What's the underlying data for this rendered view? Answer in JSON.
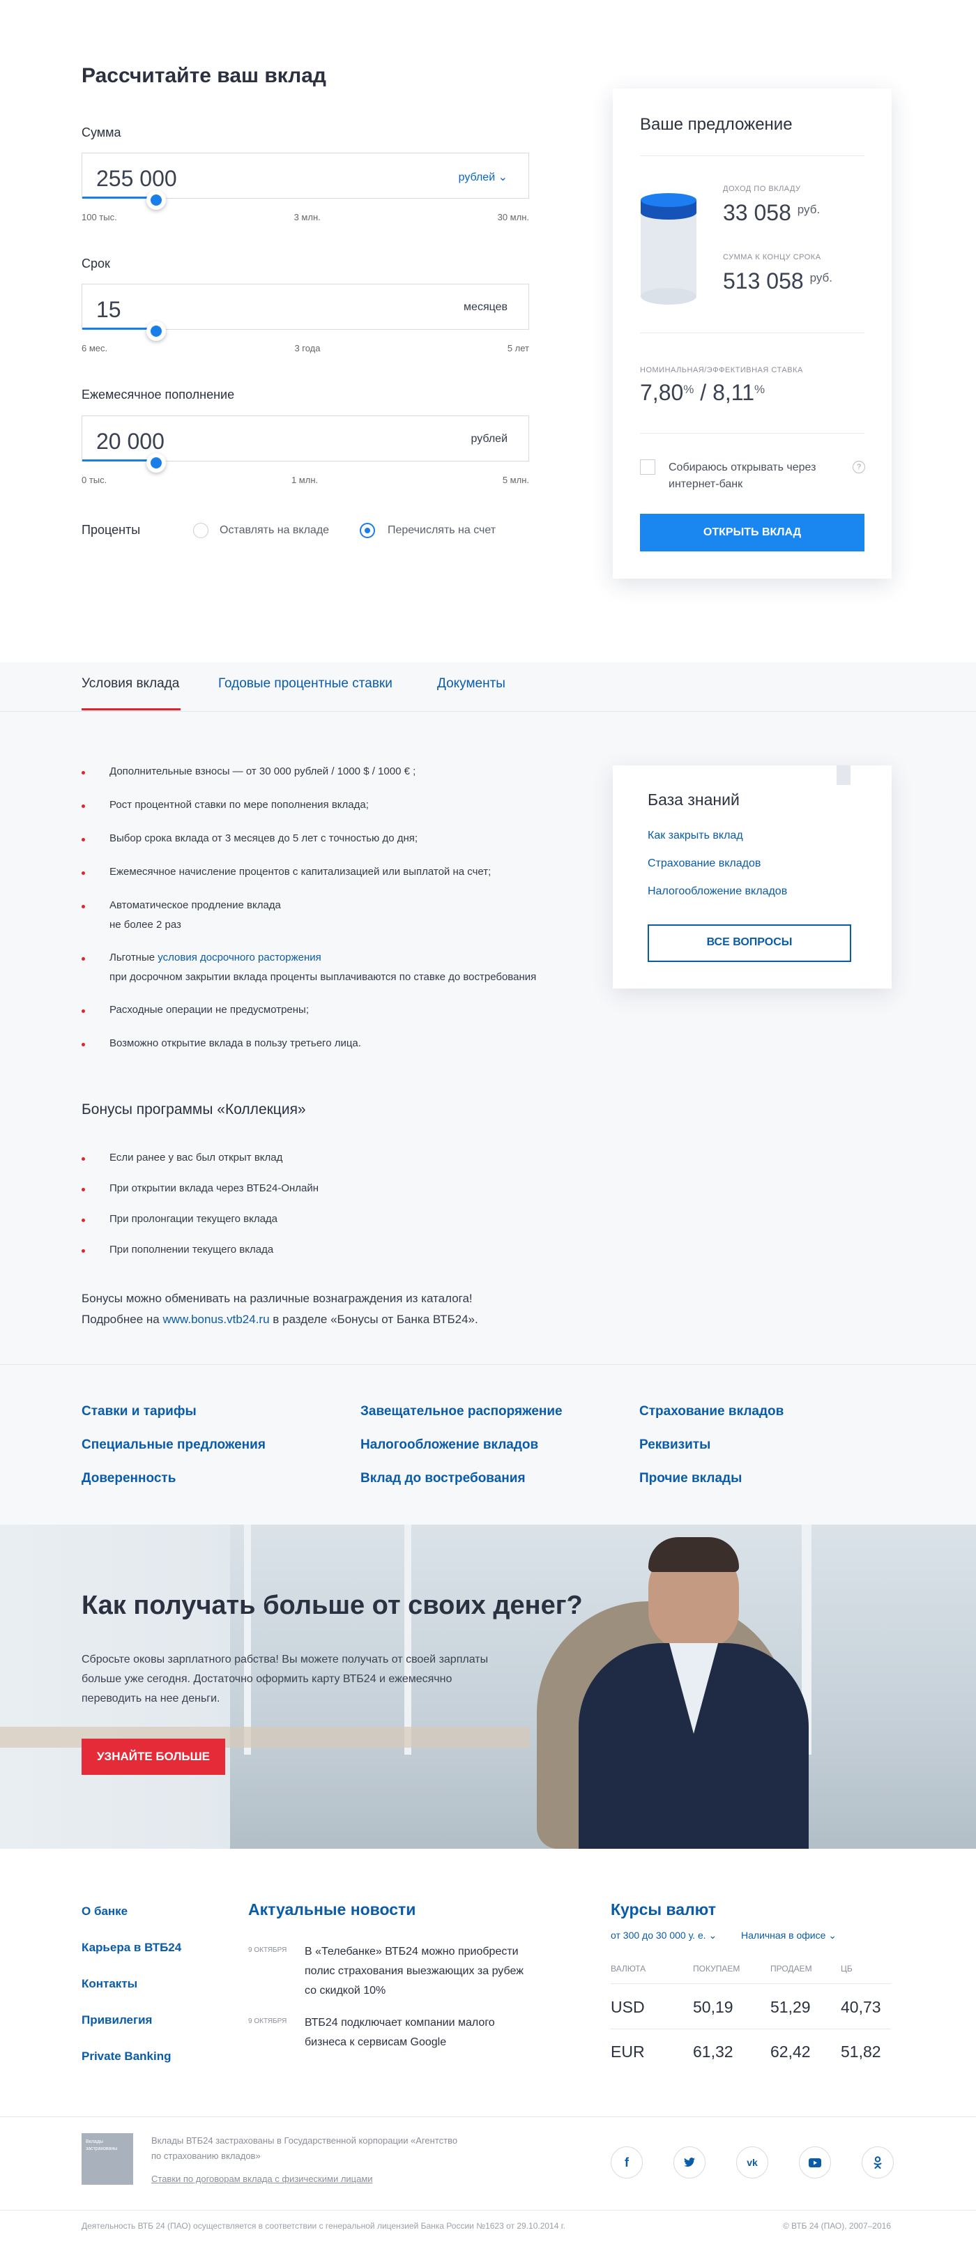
{
  "calculator": {
    "title": "Рассчитайте ваш вклад",
    "amount": {
      "label": "Сумма",
      "value": "255 000",
      "unit": "рублей",
      "ticks": [
        "100 тыс.",
        "3 млн.",
        "30 млн."
      ]
    },
    "term": {
      "label": "Срок",
      "value": "15",
      "unit": "месяцев",
      "ticks": [
        "6 мес.",
        "3 года",
        "5 лет"
      ]
    },
    "topup": {
      "label": "Ежемесячное пополнение",
      "value": "20 000",
      "unit": "рублей",
      "ticks": [
        "0 тыс.",
        "1 млн.",
        "5 млн."
      ]
    },
    "interest": {
      "label": "Проценты",
      "options": [
        "Оставлять на вкладе",
        "Перечислять на счет"
      ],
      "selected": "Перечислять на счет"
    }
  },
  "offer": {
    "title": "Ваше предложение",
    "income_label": "ДОХОД ПО ВКЛАДУ",
    "income_value": "33 058",
    "income_unit": "руб.",
    "total_label": "СУММА К КОНЦУ СРОКА",
    "total_value": "513 058",
    "total_unit": "руб.",
    "rate_label": "НОМИНАЛЬНАЯ/ЭФФЕКТИВНАЯ СТАВКА",
    "rate_nominal": "7,80",
    "rate_effective": "8,11",
    "rate_sep": "/",
    "percent": "%",
    "checkbox_label_1": "Собираюсь открывать через",
    "checkbox_label_2": "интернет-банк",
    "help": "?",
    "button": "ОТКРЫТЬ ВКЛАД"
  },
  "tabs": [
    "Условия вклада",
    "Годовые процентные ставки",
    "Документы"
  ],
  "conditions": [
    {
      "text": "Дополнительные взносы — от 30 000 рублей / 1000 $ / 1000 € ;"
    },
    {
      "text": "Рост процентной ставки по мере пополнения вклада;"
    },
    {
      "text": "Выбор срока вклада от 3 месяцев до 5 лет с точностью до дня;"
    },
    {
      "text": "Ежемесячное начисление процентов с капитализацией или выплатой на счет;"
    },
    {
      "text": "Автоматическое продление вклада",
      "note": "не более 2 раз"
    },
    {
      "text": "Льготные",
      "link": "условия досрочного расторжения",
      "note": "при досрочном закрытии вклада проценты выплачиваются по ставке до востребования"
    },
    {
      "text": "Расходные операции не предусмотрены;"
    },
    {
      "text": "Возможно открытие вклада в пользу третьего лица."
    }
  ],
  "knowledge": {
    "title": "База знаний",
    "links": [
      "Как закрыть вклад",
      "Страхование вкладов",
      "Налогообложение вкладов"
    ],
    "button": "ВСЕ ВОПРОСЫ"
  },
  "bonuses": {
    "title": "Бонусы программы «Коллекция»",
    "items": [
      "Если ранее у вас был открыт вклад",
      "При открытии вклада через ВТБ24-Онлайн",
      "При пролонгации текущего вклада",
      "При пополнении текущего вклада"
    ],
    "note1": "Бонусы можно обменивать на различные вознаграждения из каталога!",
    "note2_pre": "Подробнее на",
    "note2_link": "www.bonus.vtb24.ru",
    "note2_post": "в разделе «Бонусы от Банка ВТБ24»."
  },
  "footer_links": [
    [
      "Ставки и тарифы",
      "Специальные предложения",
      "Доверенность"
    ],
    [
      "Завещательное распоряжение",
      "Налогообложение вкладов",
      "Вклад до востребования"
    ],
    [
      "Страхование вкладов",
      "Реквизиты",
      "Прочие вклады"
    ]
  ],
  "banner": {
    "title": "Как получать больше от своих денег?",
    "text": [
      "Сбросьте оковы зарплатного рабства! Вы можете получать от своей зарплаты",
      "больше уже сегодня. Достаточно оформить карту ВТБ24 и ежемесячно",
      "переводить на нее деньги."
    ],
    "button": "УЗНАЙТЕ БОЛЬШЕ"
  },
  "footer_nav": [
    "О банке",
    "Карьера в ВТБ24",
    "Контакты",
    "Привилегия",
    "Private Banking"
  ],
  "news": {
    "title": "Актуальные новости",
    "items": [
      {
        "date": "9 ОКТЯБРЯ",
        "lines": [
          "В «Телебанке» ВТБ24 можно приобрести",
          "полис страхования выезжающих за рубеж",
          "со скидкой 10%"
        ]
      },
      {
        "date": "9 ОКТЯБРЯ",
        "lines": [
          "ВТБ24 подключает компании малого",
          "бизнеса к сервисам Google"
        ]
      }
    ]
  },
  "rates": {
    "title": "Курсы валют",
    "filter_amount": "от 300 до 30 000 у. е.",
    "filter_type": "Наличная в офисе",
    "headers": [
      "ВАЛЮТА",
      "ПОКУПАЕМ",
      "ПРОДАЕМ",
      "ЦБ"
    ],
    "rows": [
      [
        "USD",
        "50,19",
        "51,29",
        "40,73"
      ],
      [
        "EUR",
        "61,32",
        "62,42",
        "51,82"
      ]
    ]
  },
  "insurance": {
    "badge_line1": "Вклады",
    "badge_line2": "застрахованы",
    "text_line1": "Вклады ВТБ24 застрахованы в Государственной корпорации «Агентство",
    "text_line2": "по страхованию вкладов»",
    "link": "Ставки по договорам вклада с физическими лицами"
  },
  "social": [
    "f",
    "t",
    "vk",
    "yt",
    "ok"
  ],
  "legal": {
    "left": "Деятельность ВТБ 24 (ПАО) осуществляется в соответствии с генеральной лицензией Банка России №1623 от 29.10.2014 г.",
    "right": "© ВТБ 24 (ПАО), 2007–2016"
  }
}
